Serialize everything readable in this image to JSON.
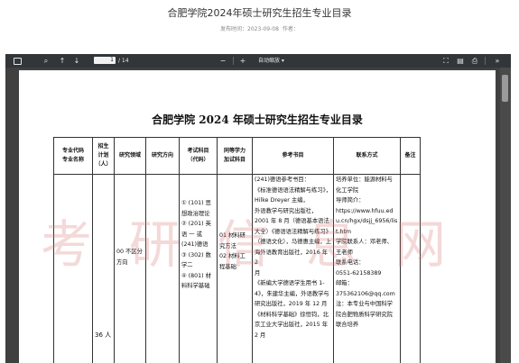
{
  "article": {
    "title": "合肥学院2024年硕士研究生招生专业目录",
    "publish_label": "发布时间：2023-09-08",
    "author_label": "作者："
  },
  "viewer": {
    "toolbar": {
      "current_page": "1",
      "total_pages": "/ 14",
      "zoom_label": "自动缩放",
      "zoom_out": "−",
      "zoom_in": "+"
    },
    "icons": [
      "sidebar-toggle-icon",
      "search-icon",
      "up-arrow-icon",
      "down-arrow-icon",
      "presentation-icon",
      "open-file-icon",
      "print-icon",
      "more-tools-icon"
    ]
  },
  "document": {
    "title": "合肥学院 2024 年硕士研究生招生专业目录",
    "table": {
      "headers": [
        [
          "专业代码",
          "专业名称"
        ],
        [
          "招生",
          "计划",
          "（人）"
        ],
        [
          "研究领域"
        ],
        [
          "研究方向"
        ],
        [
          "考试科目",
          "（代码）"
        ],
        [
          "同等学力",
          "加试科目"
        ],
        [
          "参考书目"
        ],
        [
          "联系方式"
        ],
        [
          "备注"
        ]
      ],
      "row": {
        "plan": "36 人",
        "field": "00 不区分方向",
        "exams": [
          "① (101) 思想政治理论",
          "② (201) 英语 一 或(241)德语",
          "③ (302) 数学二",
          "④ (801) 材料科学基础"
        ],
        "equivalent": [
          "01 材料研究方法",
          "02 材料工程基础"
        ],
        "books": [
          "(241)德语参考书目：",
          "《标准德语语法精解与练习》，Hilke Dreyer 主编，",
          "外语教学与研究出版社，",
          "2001 年 8 月（德语基本语法大全）《德语语法精解与练习》（德语文化），马德惠主编，上海外语教育出版社，2016 年 2",
          "月",
          "《新编大学德语学生用书 1-4》，朱建华主编，外语教学与研究出版社，2019 年 12 月",
          "《材料科学基础》徐恒钧，北京工业大学出版社，2015 年 2 月"
        ],
        "contact": [
          "培养单位：能源材料与化工学院",
          "导师简介：",
          "https://www.hfuu.edu.cn/hgx/dsjj_6956/list.htm",
          "学院联系人：邓老师、王老师",
          "联系电话：",
          "0551-62158389",
          "邮箱：",
          "375362106@qq.com",
          "注：本专业与中国科学院合肥物质科学研究院联合培养"
        ]
      }
    },
    "watermark": [
      "考",
      "研",
      "信",
      "息",
      "网"
    ]
  }
}
